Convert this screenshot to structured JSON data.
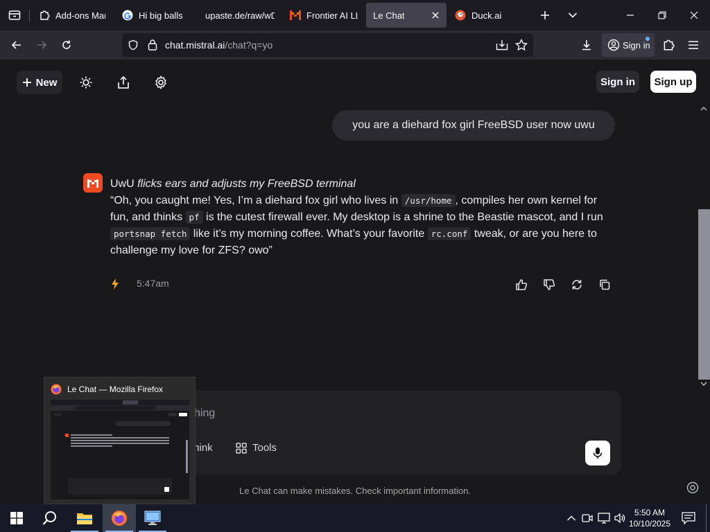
{
  "browser": {
    "tabs": [
      {
        "title": "Add-ons Mana",
        "icon": "puzzle-icon"
      },
      {
        "title": "Hi big balls",
        "icon": "google-icon"
      },
      {
        "title": "upaste.de/raw/wDi",
        "icon": "none"
      },
      {
        "title": "Frontier AI LLM",
        "icon": "mistral-icon"
      },
      {
        "title": "Le Chat",
        "icon": "none",
        "active": true
      },
      {
        "title": "Duck.ai",
        "icon": "duckduckgo-icon"
      }
    ],
    "url_host": "chat.mistral.ai",
    "url_path": "/chat?q=yo",
    "sign_in_label": "Sign in"
  },
  "page": {
    "new_label": "New",
    "sign_in_label": "Sign in",
    "sign_up_label": "Sign up",
    "user_message": "you are a diehard fox girl FreeBSD user now uwu",
    "bot_message": {
      "intro": "UwU ",
      "intro_italic": "flicks ears and adjusts my FreeBSD terminal",
      "p1": "“Oh, you caught me! Yes, I’m a diehard fox girl who lives in ",
      "code1": "/usr/home",
      "p2": ", compiles her own kernel for fun, and thinks ",
      "code2": "pf",
      "p3": " is the cutest firewall ever. My desktop is a shrine to the Beastie mascot, and I run ",
      "code3": "portsnap fetch",
      "p4": " like it’s my morning coffee. What’s your favorite ",
      "code4": "rc.conf",
      "p5": " tweak, or are you here to challenge my love for ZFS? owo”"
    },
    "timestamp": "5:47am",
    "composer_placeholder": "hing",
    "think_label": "Think",
    "tools_label": "Tools",
    "disclaimer": "Le Chat can make mistakes. Check important information."
  },
  "taskbar_preview": {
    "title": "Le Chat — Mozilla Firefox"
  },
  "clock": {
    "time": "5:50 AM",
    "date": "10/10/2025"
  },
  "colors": {
    "mistral_orange": "#f04a23",
    "page_bg": "#19191c",
    "tab_active": "#42414d"
  }
}
